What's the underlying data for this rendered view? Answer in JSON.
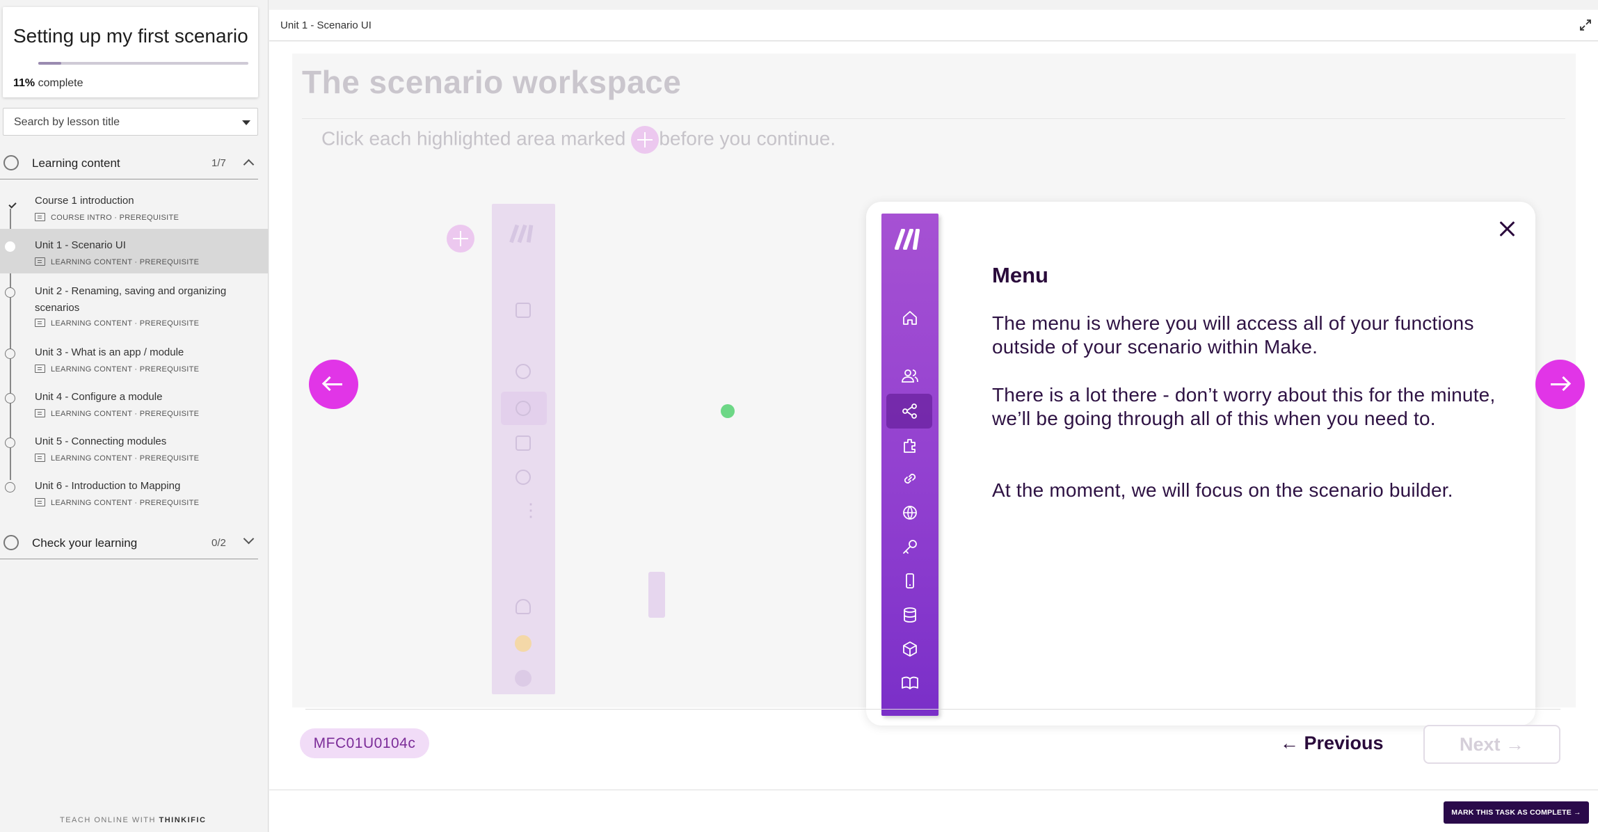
{
  "sidebar": {
    "course_title": "Setting up my first scenario",
    "progress": {
      "percent_label": "11%",
      "suffix": " complete",
      "fraction": 0.11
    },
    "search_placeholder": "Search by lesson title",
    "chapters": [
      {
        "title": "Learning content",
        "count": "1/7",
        "expanded": true
      },
      {
        "title": "Check your learning",
        "count": "0/2",
        "expanded": false
      }
    ],
    "lessons": [
      {
        "title": "Course 1 introduction",
        "type": "COURSE INTRO",
        "tag": "PREREQUISITE",
        "completed": true
      },
      {
        "title": "Unit 1 - Scenario UI",
        "type": "LEARNING CONTENT",
        "tag": "PREREQUISITE",
        "active": true
      },
      {
        "title": "Unit 2 - Renaming, saving and organizing scenarios",
        "type": "LEARNING CONTENT",
        "tag": "PREREQUISITE"
      },
      {
        "title": "Unit 3 - What is an app / module",
        "type": "LEARNING CONTENT",
        "tag": "PREREQUISITE"
      },
      {
        "title": "Unit 4 - Configure a module",
        "type": "LEARNING CONTENT",
        "tag": "PREREQUISITE"
      },
      {
        "title": "Unit 5 - Connecting modules",
        "type": "LEARNING CONTENT",
        "tag": "PREREQUISITE"
      },
      {
        "title": "Unit 6 - Introduction to Mapping",
        "type": "LEARNING CONTENT",
        "tag": "PREREQUISITE"
      }
    ],
    "meta_separator": " · ",
    "footer_prefix": "TEACH ONLINE WITH ",
    "footer_brand": "THINKIFIC"
  },
  "topbar": {
    "lesson_title": "Unit 1 - Scenario UI"
  },
  "slide": {
    "heading": "The scenario workspace",
    "instruction_before": "Click each highlighted area marked",
    "instruction_after": "before you continue.",
    "modal": {
      "heading": "Menu",
      "paragraphs": [
        "The menu is where you will access all of your functions outside of your scenario within Make.",
        "There is a lot there - don’t worry about this for the minute, we’ll be going through all of this when you need to.",
        "At the moment, we will focus on the scenario builder."
      ],
      "menu_icons": [
        "make-logo-icon",
        "home-icon",
        "team-icon",
        "scenarios-icon",
        "templates-icon",
        "connections-icon",
        "webhooks-icon",
        "keys-icon",
        "devices-icon",
        "data-stores-icon",
        "data-structures-icon",
        "docs-icon"
      ]
    }
  },
  "nav": {
    "code": "MFC01U0104c",
    "previous_label": "← Previous",
    "next_label": "Next →"
  },
  "footer": {
    "mark_complete_label": "MARK THIS TASK AS COMPLETE →"
  },
  "colors": {
    "accent_magenta": "#e135e7",
    "menu_purple": "#9a45d2",
    "dark_purple": "#2a0a4a"
  }
}
